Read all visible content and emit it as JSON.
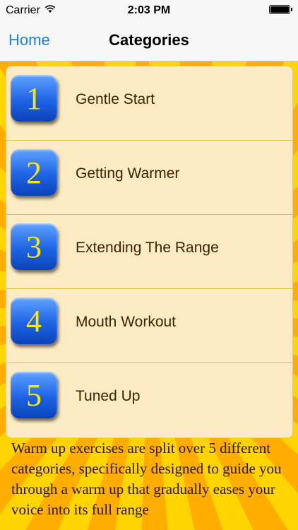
{
  "status_bar": {
    "carrier": "Carrier",
    "time": "2:03 PM",
    "wifi_icon": "wifi-icon",
    "battery_icon": "battery-icon"
  },
  "nav": {
    "back_label": "Home",
    "title": "Categories"
  },
  "categories": [
    {
      "number": "1",
      "label": "Gentle Start"
    },
    {
      "number": "2",
      "label": "Getting Warmer"
    },
    {
      "number": "3",
      "label": "Extending The Range"
    },
    {
      "number": "4",
      "label": "Mouth Workout"
    },
    {
      "number": "5",
      "label": "Tuned Up"
    }
  ],
  "description": "Warm up exercises are split over 5 different categories, specifically designed to guide you through a warm up that gradually eases your voice into its full range",
  "colors": {
    "accent": "#1a7ff2",
    "icon_blue": "#1e63e6",
    "number_yellow": "#ffe600",
    "row_bg": "#fdecc3"
  }
}
